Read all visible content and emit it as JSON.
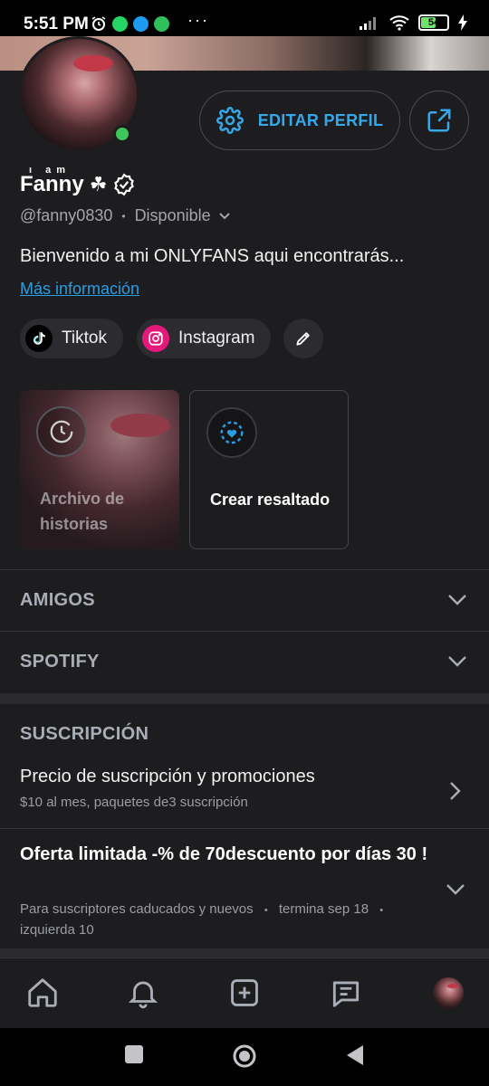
{
  "status_bar": {
    "time": "5:51 PM",
    "battery": "54",
    "app_icons": [
      "alarm-icon",
      "whatsapp-icon",
      "twitter-icon",
      "notification-icon"
    ],
    "more": "···",
    "colors": {
      "whatsapp": "#25d366",
      "twitter": "#1d9bf0",
      "k": "#2fbf5d",
      "battery": "#6ee26a"
    }
  },
  "profile": {
    "edit_button": "EDITAR PERFIL",
    "name": "Fanny",
    "name_decoration": "ı am",
    "clover": "☘",
    "handle": "@fanny0830",
    "separator": "•",
    "status": "Disponible",
    "bio": "Bienvenido a mi ONLYFANS aqui encontrarás...",
    "more_info": "Más información",
    "accent_color": "#36a8e8"
  },
  "social_links": [
    {
      "label": "Tiktok",
      "icon": "tiktok-icon"
    },
    {
      "label": "Instagram",
      "icon": "instagram-icon"
    }
  ],
  "highlights": [
    {
      "label": "Archivo de historias",
      "icon": "clock-icon"
    },
    {
      "label": "Crear resaltado",
      "icon": "heart-plus-icon"
    }
  ],
  "sections": {
    "friends": "AMIGOS",
    "spotify": "SPOTIFY",
    "subscription": "SUSCRIPCIÓN"
  },
  "subscription": {
    "price_title": "Precio de suscripción y promociones",
    "price_sub": "$10 al mes, paquetes de3 suscripción",
    "offer_title": "Oferta limitada -% de 70descuento por días 30 !",
    "offer_sub_1": "Para suscriptores caducados y nuevos",
    "offer_sub_2": "termina sep 18",
    "offer_sub_3": "izquierda 10",
    "dot": "•"
  },
  "bottom_nav": [
    "home-icon",
    "bell-icon",
    "plus-square-icon",
    "chat-icon",
    "profile-avatar"
  ]
}
